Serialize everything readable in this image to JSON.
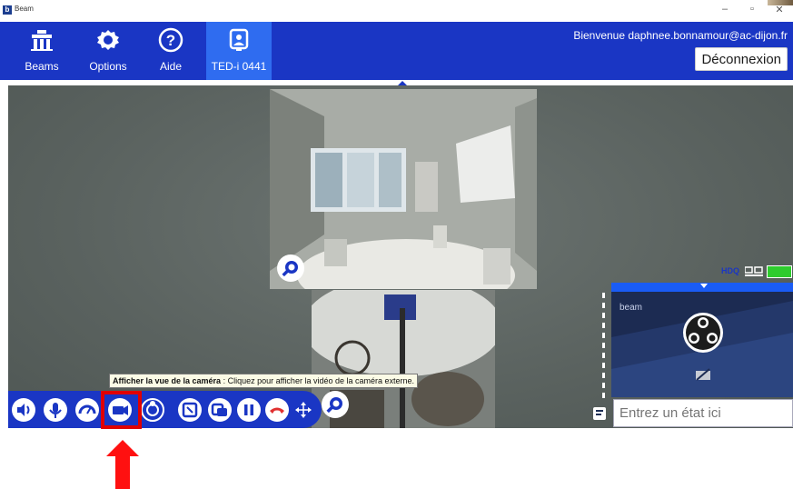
{
  "window": {
    "title": "Beam",
    "minimize_label": "–",
    "restore_label": "▫",
    "close_label": "✕"
  },
  "nav": {
    "items": [
      {
        "label": "Beams",
        "icon": "beams-icon"
      },
      {
        "label": "Options",
        "icon": "gear-icon"
      },
      {
        "label": "Aide",
        "icon": "help-icon"
      },
      {
        "label": "TED-i 0441",
        "icon": "robot-icon",
        "active": true
      }
    ],
    "welcome": "Bienvenue daphnee.bonnamour@ac-dijon.fr",
    "logout": "Déconnexion"
  },
  "video": {
    "hd_label": "HDQ",
    "self_view_brand": "beam",
    "status_placeholder": "Entrez un état ici"
  },
  "controls": {
    "buttons": [
      "volume-icon",
      "microphone-icon",
      "speed-gauge-icon",
      "external-camera-icon",
      "camera-switch-icon",
      "fullscreen-icon",
      "picture-in-picture-icon",
      "pause-icon",
      "hang-up-icon",
      "move-icon",
      "zoom-icon"
    ]
  },
  "tooltip": {
    "title": "Afficher la vue de la caméra",
    "text": " : Cliquez pour afficher la vidéo de la caméra externe."
  },
  "colors": {
    "nav": "#1a36c4",
    "nav_active": "#2f6cf0",
    "highlight": "#e00000",
    "signal": "#2ecc2e"
  }
}
